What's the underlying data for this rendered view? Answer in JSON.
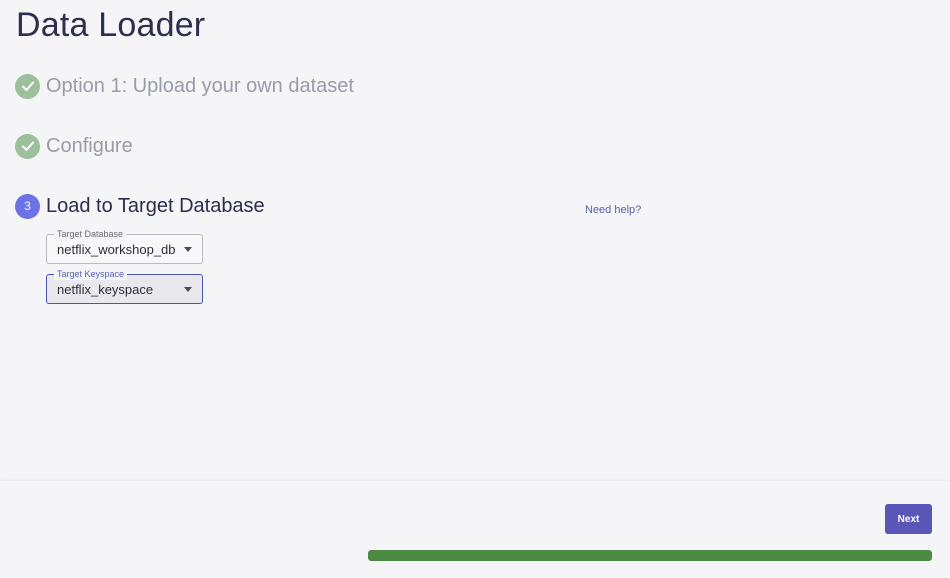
{
  "page": {
    "title": "Data Loader"
  },
  "steps": [
    {
      "number": "1",
      "label": "Option 1: Upload your own dataset",
      "status": "complete",
      "icon": "check-icon"
    },
    {
      "number": "2",
      "label": "Configure",
      "status": "complete",
      "icon": "check-icon"
    },
    {
      "number": "3",
      "label": "Load to Target Database",
      "status": "active"
    }
  ],
  "help": {
    "label": "Need help?"
  },
  "form": {
    "target_database": {
      "label": "Target Database",
      "value": "netflix_workshop_db"
    },
    "target_keyspace": {
      "label": "Target Keyspace",
      "value": "netflix_keyspace"
    }
  },
  "footer": {
    "next_label": "Next",
    "progress": 1.0
  },
  "colors": {
    "complete_step": "#9cbf9c",
    "active_step": "#6b73e6",
    "primary_button": "#5956b8",
    "progress_fill": "#4c8a44",
    "focus_border": "#4a54b8"
  }
}
